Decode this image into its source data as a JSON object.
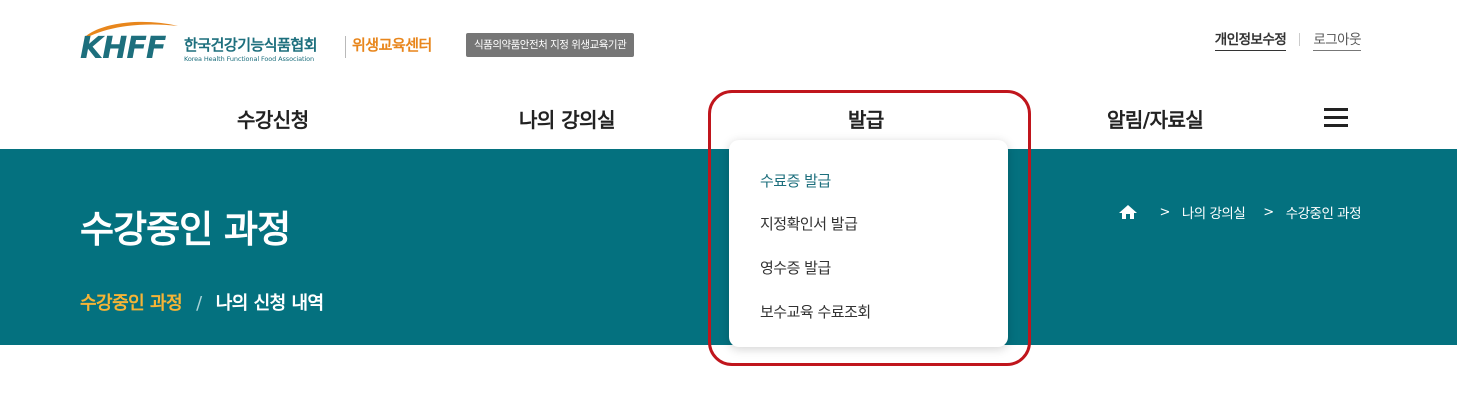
{
  "header": {
    "logo_text": "KHFF",
    "org_name_ko": "한국건강기능식품협회",
    "org_name_en": "Korea Health Functional Food Association",
    "center_name": "위생교육센터",
    "badge": "식품의약품안전처 지정 위생교육기관",
    "util": {
      "edit_profile": "개인정보수정",
      "logout": "로그아웃"
    }
  },
  "gnb": {
    "items": [
      {
        "label": "수강신청"
      },
      {
        "label": "나의 강의실"
      },
      {
        "label": "발급"
      },
      {
        "label": "알림/자료실"
      }
    ],
    "menu_icon": "hamburger-icon"
  },
  "dropdown": {
    "items": [
      {
        "label": "수료증 발급",
        "active": true
      },
      {
        "label": "지정확인서 발급",
        "active": false
      },
      {
        "label": "영수증 발급",
        "active": false
      },
      {
        "label": "보수교육 수료조회",
        "active": false
      }
    ]
  },
  "banner": {
    "title": "수강중인 과정",
    "tabs": {
      "active": "수강중인 과정",
      "separator": "/",
      "other": "나의 신청 내역"
    },
    "breadcrumb": {
      "home_icon": "home-icon",
      "items": [
        "나의 강의실",
        "수강중인 과정"
      ]
    }
  },
  "colors": {
    "banner_bg": "#04717f",
    "brand_teal": "#1d6f7d",
    "brand_orange": "#e8861c",
    "active_tab": "#f5b436",
    "highlight_border": "#c0151c"
  }
}
